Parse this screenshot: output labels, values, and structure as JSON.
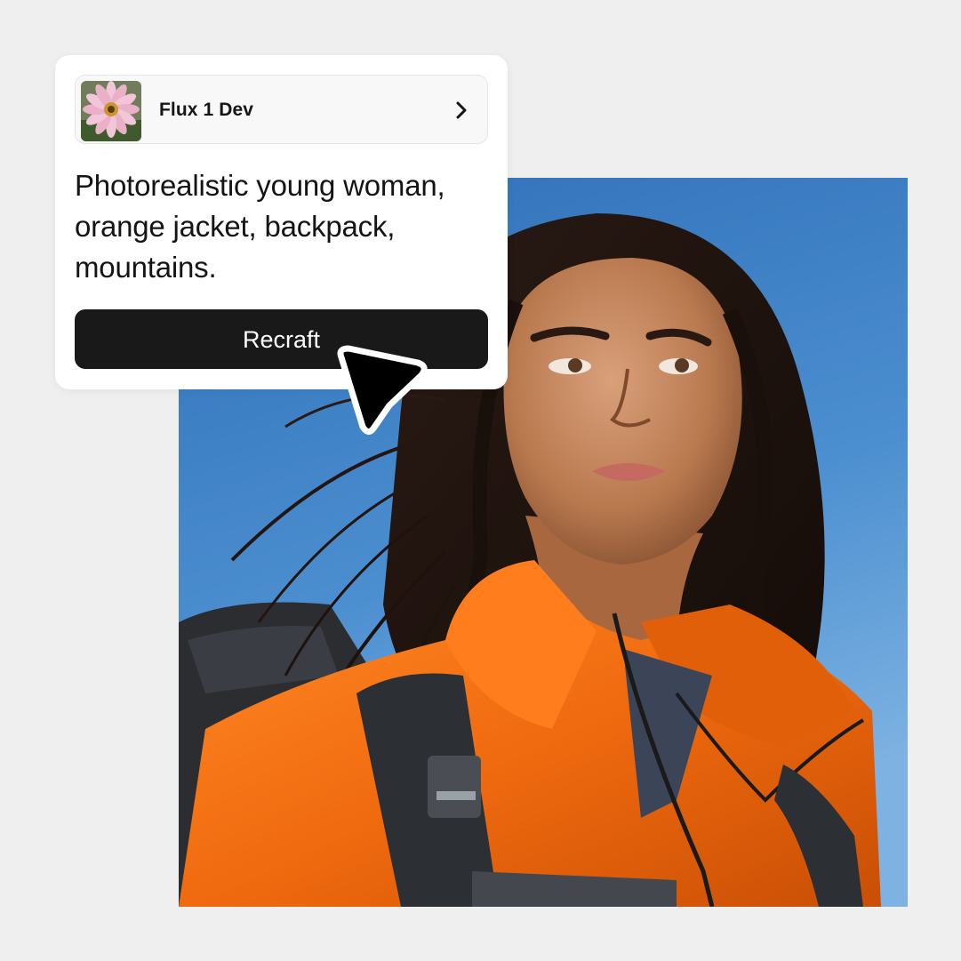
{
  "model": {
    "name": "Flux 1 Dev",
    "thumbnail_icon": "flower-thumbnail-icon",
    "chevron_icon": "chevron-right-icon"
  },
  "prompt": {
    "text": "Photorealistic young woman, orange jacket, backpack, mountains."
  },
  "action": {
    "label": "Recraft"
  },
  "cursor_icon": "arrow-pointer-icon",
  "colors": {
    "background": "#efefef",
    "card": "#ffffff",
    "button": "#191919",
    "button_text": "#ffffff",
    "sky": "#3b7fc4",
    "jacket": "#f06a0f"
  }
}
